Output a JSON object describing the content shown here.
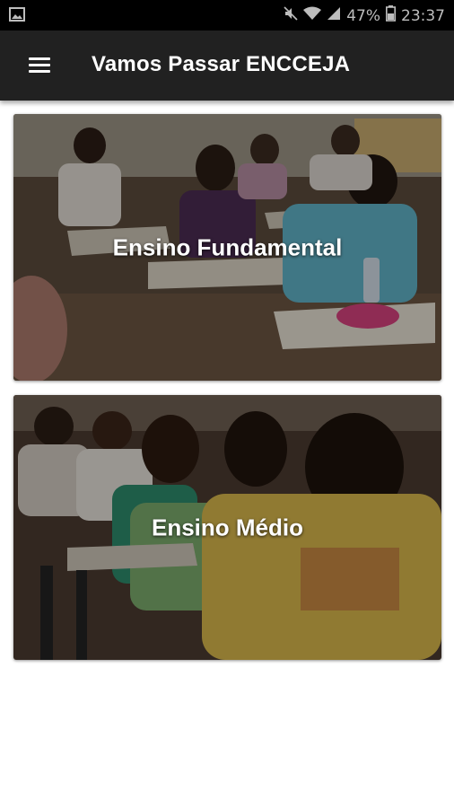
{
  "status_bar": {
    "battery": "47%",
    "time": "23:37"
  },
  "app_bar": {
    "title": "Vamos Passar ENCCEJA",
    "menu_icon": "hamburger-menu-icon"
  },
  "cards": [
    {
      "label": "Ensino Fundamental"
    },
    {
      "label": "Ensino Médio"
    }
  ],
  "colors": {
    "status_bar": "#000000",
    "app_bar": "#212121",
    "background": "#ffffff",
    "card_text": "#ffffff"
  }
}
